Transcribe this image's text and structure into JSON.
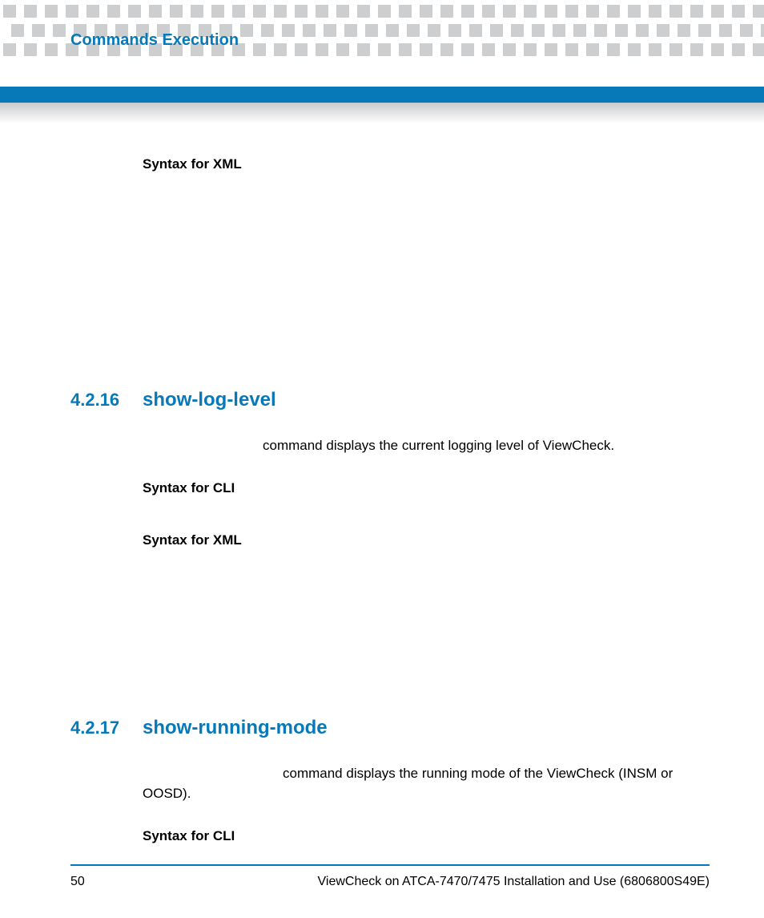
{
  "chapter_title": "Commands Execution",
  "labels": {
    "syntax_xml": "Syntax for XML",
    "syntax_cli": "Syntax for CLI"
  },
  "sections": {
    "s4216": {
      "number": "4.2.16",
      "title": "show-log-level",
      "description_tail": "command displays the current logging level of ViewCheck."
    },
    "s4217": {
      "number": "4.2.17",
      "title": "show-running-mode",
      "description_tail_line1": "command displays the running mode of the ViewCheck (INSM or",
      "description_tail_line2": "OOSD)."
    }
  },
  "footer": {
    "page_number": "50",
    "doc_title": "ViewCheck on ATCA-7470/7475 Installation and Use (6806800S49E)"
  }
}
